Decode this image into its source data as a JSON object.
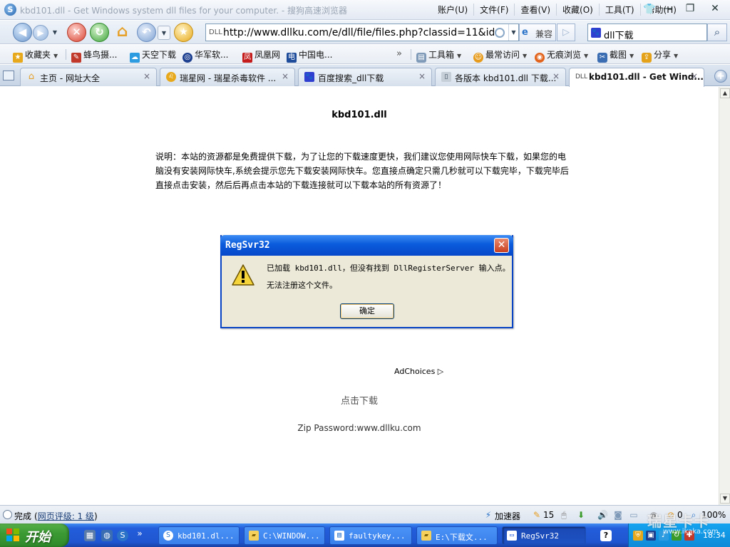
{
  "window": {
    "title": "kbd101.dll - Get Windows system dll files for your computer. - 搜狗高速浏览器",
    "menus": [
      "账户(U)",
      "文件(F)",
      "查看(V)",
      "收藏(O)",
      "工具(T)",
      "帮助(H)"
    ],
    "minimize": "—",
    "maximize": "❐",
    "close": "✕"
  },
  "navbar": {
    "back": "◀",
    "forward": "▶",
    "dropdown": "▼",
    "stop": "✕",
    "refresh": "↻",
    "home": "⌂",
    "undo": "↶",
    "favorite": "★",
    "address_prefix": "DLL",
    "address": "http://www.dllku.com/e/dll/file/files.php?classid=11&id=836",
    "compat_mode": "兼容",
    "go": "▷",
    "search_query": "dll下载",
    "search_icon": "⌕"
  },
  "bookmarks": {
    "favorites": "收藏夹",
    "items": [
      "蜂鸟摄...",
      "天空下载",
      "华军软...",
      "凤凰网",
      "中国电..."
    ],
    "more": "»",
    "tools": [
      "工具箱",
      "最常访问",
      "无痕浏览",
      "截图",
      "分享"
    ]
  },
  "tabs": [
    {
      "label": "主页 - 网址大全",
      "active": false
    },
    {
      "label": "瑞星网 - 瑞星杀毒软件 ...",
      "active": false
    },
    {
      "label": "百度搜索_dll下载",
      "active": false
    },
    {
      "label": "各版本 kbd101.dll 下载...",
      "active": false
    },
    {
      "label": "kbd101.dll - Get Wind...",
      "active": true
    }
  ],
  "tab_icon_text": "DLL",
  "tab_close": "×",
  "new_tab": "+",
  "page": {
    "heading": "kbd101.dll",
    "notice": "说明：本站的资源都是免费提供下载，为了让您的下载速度更快，我们建议您使用网际快车下载，如果您的电脑没有安装网际快车,系统会提示您先下载安装网际快车。您直接点确定只需几秒就可以下载完毕，下载完毕后直接点击安装，然后后再点击本站的下载连接就可以下载本站的所有资源了！",
    "adchoices": "AdChoices ▷",
    "download_link": "点击下载",
    "zip_password": "Zip Password:www.dllku.com"
  },
  "dialog": {
    "title": "RegSvr32",
    "close": "✕",
    "message_line1": "已加载 kbd101.dll，但没有找到 DllRegisterServer 输入点。",
    "message_line2": "无法注册这个文件。",
    "ok": "确定"
  },
  "statusbar": {
    "status": "完成",
    "rating": "网页评级: 1 级",
    "accelerator": "加速器",
    "count": "15",
    "count2": "0",
    "zoom": "100%"
  },
  "taskbar": {
    "start": "开始",
    "quick_more": "»",
    "tasks": [
      {
        "label": "kbd101.dl...",
        "active": false
      },
      {
        "label": "C:\\WINDOW...",
        "active": false
      },
      {
        "label": "faultykey...",
        "active": false
      },
      {
        "label": "E:\\下载文...",
        "active": false
      },
      {
        "label": "RegSvr32",
        "active": true
      }
    ],
    "help": "?",
    "clock": "18:34"
  },
  "watermark": {
    "brand": "瑞星卡卡",
    "url": "www.ikaka.com"
  },
  "colors": {
    "taskbar": "#245edb",
    "start": "#3c9a34",
    "dialog_title": "#0a5bdc",
    "dialog_body": "#ece9d8"
  }
}
